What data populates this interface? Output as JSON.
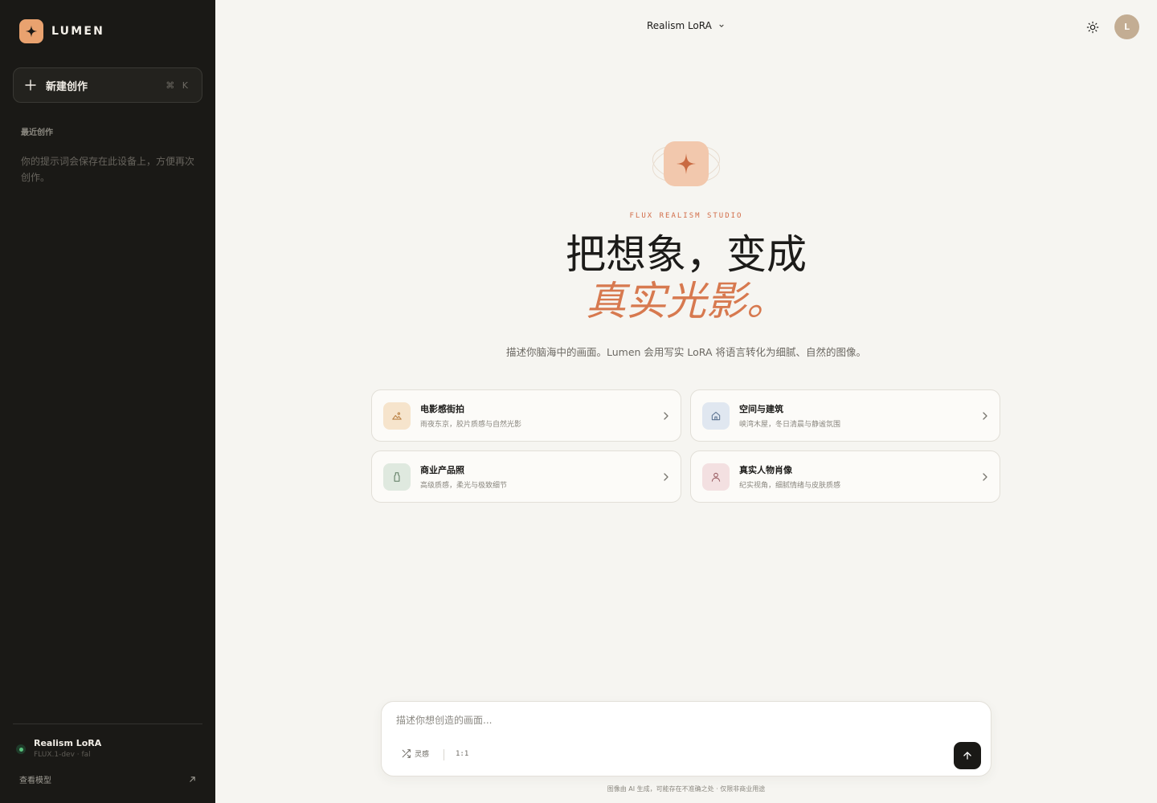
{
  "sidebar": {
    "brand_name": "LUMEN",
    "new_button_label": "新建创作",
    "new_button_shortcut": "⌘ K",
    "recent_title": "最近创作",
    "recent_empty": "你的提示词会保存在此设备上，方便再次创作。",
    "model_name": "Realism LoRA",
    "model_sub": "FLUX.1-dev · fal",
    "view_models_label": "查看模型"
  },
  "topbar": {
    "model_select_label": "Realism LoRA",
    "avatar_initial": "L"
  },
  "hero": {
    "tag": "FLUX REALISM STUDIO",
    "line1": "把想象，变成",
    "line2": "真实光影。",
    "description": "描述你脑海中的画面。Lumen 会用写实 LoRA 将语言转化为细腻、自然的图像。"
  },
  "cards": [
    {
      "title": "电影感街拍",
      "subtitle": "雨夜东京，胶片质感与自然光影",
      "icon": "landscape-icon"
    },
    {
      "title": "空间与建筑",
      "subtitle": "峡湾木屋，冬日清晨与静谧氛围",
      "icon": "home-icon"
    },
    {
      "title": "商业产品照",
      "subtitle": "高级质感，柔光与极致细节",
      "icon": "bottle-icon"
    },
    {
      "title": "真实人物肖像",
      "subtitle": "纪实视角，细腻情绪与皮肤质感",
      "icon": "person-icon"
    }
  ],
  "prompt": {
    "placeholder": "描述你想创造的画面...",
    "inspire_label": "灵感",
    "ratio_label": "1:1"
  },
  "footer_note": "图像由 AI 生成，可能存在不准确之处 · 仅限非商业用途",
  "colors": {
    "sidebar_bg": "#1a1916",
    "page_bg": "#f6f5f1",
    "accent": "#d7794f",
    "brand_mark": "#e9a26f",
    "status_green": "#58c27d"
  }
}
